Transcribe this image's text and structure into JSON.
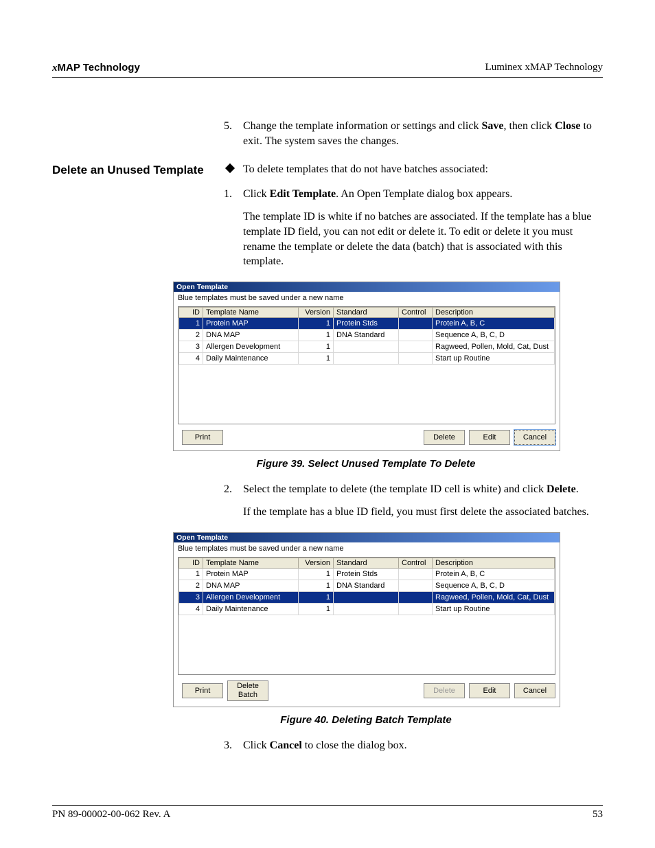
{
  "header": {
    "left_prefix": "x",
    "left_text": "MAP Technology",
    "right": "Luminex xMAP Technology"
  },
  "step5": {
    "num": "5.",
    "text_a": "Change the template information or settings and click ",
    "save": "Save",
    "text_b": ", then click ",
    "close": "Close",
    "text_c": " to exit. The system saves the changes."
  },
  "section_title": "Delete an Unused Template",
  "bullet_intro": "To delete templates that do not have batches associated:",
  "step1": {
    "num": "1.",
    "a": "Click ",
    "b": "Edit Template",
    "c": ". An Open Template dialog box appears."
  },
  "para_after1": "The template ID is white if no batches are associated. If the template has a blue template ID field, you can not edit or delete it. To edit or delete it you must rename the template or delete the data (batch) that is associated with this template.",
  "dialog": {
    "title": "Open Template",
    "subtitle": "Blue templates must be saved under a new name",
    "cols": {
      "id": "ID",
      "name": "Template Name",
      "ver": "Version",
      "std": "Standard",
      "ctrl": "Control",
      "desc": "Description"
    },
    "rows": [
      {
        "id": "1",
        "name": "Protein MAP",
        "ver": "1",
        "std": "Protein Stds",
        "ctrl": "",
        "desc": "Protein A, B, C"
      },
      {
        "id": "2",
        "name": "DNA MAP",
        "ver": "1",
        "std": "DNA Standard",
        "ctrl": "",
        "desc": "Sequence A, B, C, D"
      },
      {
        "id": "3",
        "name": "Allergen Development",
        "ver": "1",
        "std": "",
        "ctrl": "",
        "desc": "Ragweed, Pollen, Mold, Cat, Dust"
      },
      {
        "id": "4",
        "name": "Daily Maintenance",
        "ver": "1",
        "std": "",
        "ctrl": "",
        "desc": "Start up Routine"
      }
    ],
    "buttons": {
      "print": "Print",
      "delete_batch": "Delete\nBatch",
      "delete": "Delete",
      "edit": "Edit",
      "cancel": "Cancel"
    }
  },
  "caption39": "Figure 39.  Select Unused Template To Delete",
  "step2": {
    "num": "2.",
    "a": "Select the template to delete (the template ID cell is white) and click ",
    "b": "Delete",
    "c": "."
  },
  "para_after2": "If the template has a blue ID field, you must first delete the associated batches.",
  "caption40": "Figure 40.  Deleting Batch Template",
  "step3": {
    "num": "3.",
    "a": "Click ",
    "b": "Cancel",
    "c": " to close the dialog box."
  },
  "footer": {
    "left": "PN 89-00002-00-062 Rev. A",
    "right": "53"
  }
}
